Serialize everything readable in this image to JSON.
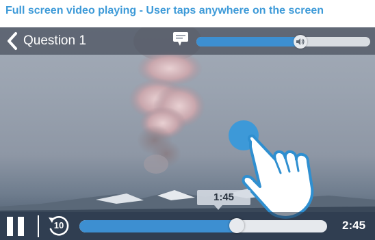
{
  "caption": "Full screen video playing - User taps anywhere on the screen",
  "video": {
    "title": "Question 1",
    "back_icon": "chevron-left-icon",
    "subtitles_icon": "speech-bubble-icon",
    "volume_level": 0.6,
    "volume_icon": "speaker-icon"
  },
  "playback": {
    "current_time": "1:45",
    "duration": "2:45",
    "progress": 0.636,
    "rewind_seconds": "10",
    "pause_icon": "pause-icon",
    "rewind_icon": "rewind-10-icon"
  },
  "gesture": {
    "hand_icon": "tap-hand-icon",
    "tap_indicator_color": "#3d99d8"
  },
  "colors": {
    "caption": "#3d9ad8",
    "accent": "#3d8fd1"
  }
}
